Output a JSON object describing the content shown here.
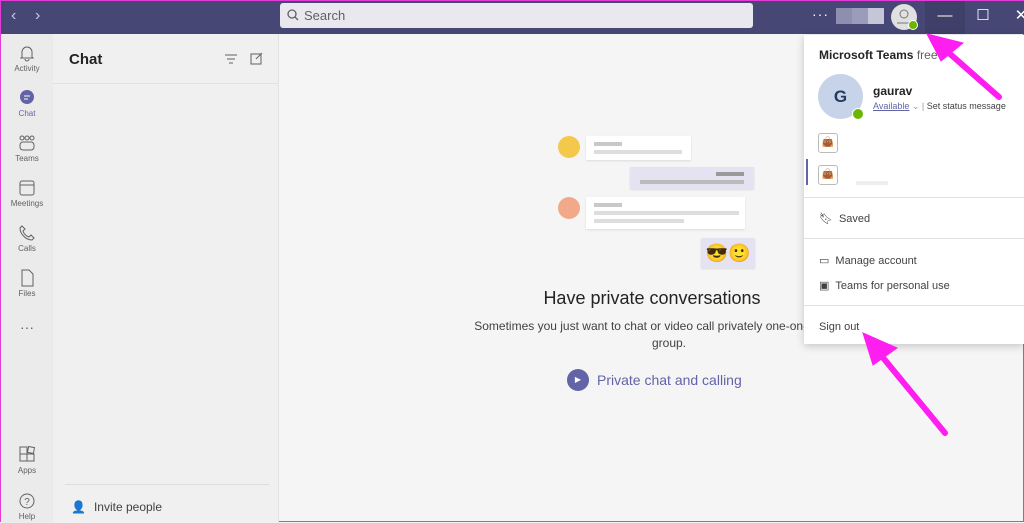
{
  "titlebar": {
    "search_placeholder": "Search",
    "more": "···",
    "minimize": "—",
    "maximize": "☐",
    "close": "✕",
    "back": "‹",
    "forward": "›"
  },
  "rail": [
    {
      "label": "Activity",
      "icon": "bell-icon"
    },
    {
      "label": "Chat",
      "icon": "chat-icon",
      "active": true
    },
    {
      "label": "Teams",
      "icon": "teams-icon"
    },
    {
      "label": "Meetings",
      "icon": "calendar-icon"
    },
    {
      "label": "Calls",
      "icon": "phone-icon"
    },
    {
      "label": "Files",
      "icon": "file-icon"
    },
    {
      "label": "···",
      "icon": "more-icon"
    }
  ],
  "rail_bottom": [
    {
      "label": "Apps",
      "icon": "apps-icon"
    },
    {
      "label": "Help",
      "icon": "help-icon"
    }
  ],
  "chat_list": {
    "title": "Chat",
    "invite": "Invite people"
  },
  "main": {
    "heading": "Have private conversations",
    "subtext": "Sometimes you just want to chat or video call privately one-on-one or in a group.",
    "link": "Private chat and calling"
  },
  "profile_menu": {
    "app": "Microsoft Teams",
    "plan": "free",
    "avatar_initial": "G",
    "name": "gaurav",
    "status": "Available",
    "set_status": "Set status message",
    "saved": "Saved",
    "manage_account": "Manage account",
    "personal_use": "Teams for personal use",
    "sign_out": "Sign out"
  },
  "colors": {
    "accent": "#6264a7",
    "titlebar": "#464775",
    "available": "#6bb700",
    "annotation": "#ff1ef0"
  }
}
